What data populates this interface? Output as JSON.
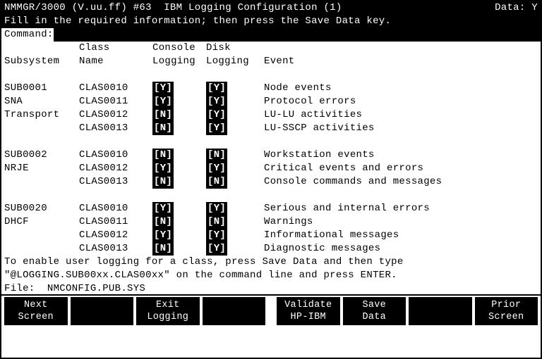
{
  "header": {
    "left": "NMMGR/3000 (V.uu.ff) #63  IBM Logging Configuration (1)",
    "right": "Data: Y",
    "instruction": "Fill in the required information; then press the Save Data key.",
    "command_label": "Command:"
  },
  "columns": {
    "subsystem": "Subsystem",
    "class_l1": "Class",
    "class_l2": "Name",
    "console_l1": "Console",
    "console_l2": "Logging",
    "disk_l1": "Disk",
    "disk_l2": "Logging",
    "event": "Event"
  },
  "groups": [
    {
      "subsystem": "SUB0001",
      "sublines": [
        "SNA",
        "Transport",
        ""
      ],
      "rows": [
        {
          "class": "CLAS0010",
          "console": "[Y]",
          "disk": "[Y]",
          "event": "Node events"
        },
        {
          "class": "CLAS0011",
          "console": "[Y]",
          "disk": "[Y]",
          "event": "Protocol errors"
        },
        {
          "class": "CLAS0012",
          "console": "[N]",
          "disk": "[Y]",
          "event": "LU-LU activities"
        },
        {
          "class": "CLAS0013",
          "console": "[N]",
          "disk": "[Y]",
          "event": "LU-SSCP activities"
        }
      ]
    },
    {
      "subsystem": "SUB0002",
      "sublines": [
        "NRJE",
        ""
      ],
      "rows": [
        {
          "class": "CLAS0010",
          "console": "[N]",
          "disk": "[N]",
          "event": "Workstation events"
        },
        {
          "class": "CLAS0012",
          "console": "[Y]",
          "disk": "[Y]",
          "event": "Critical events and errors"
        },
        {
          "class": "CLAS0013",
          "console": "[N]",
          "disk": "[N]",
          "event": "Console commands and messages"
        }
      ]
    },
    {
      "subsystem": "SUB0020",
      "sublines": [
        "DHCF",
        "",
        ""
      ],
      "rows": [
        {
          "class": "CLAS0010",
          "console": "[Y]",
          "disk": "[Y]",
          "event": "Serious and internal errors"
        },
        {
          "class": "CLAS0011",
          "console": "[N]",
          "disk": "[N]",
          "event": "Warnings"
        },
        {
          "class": "CLAS0012",
          "console": "[Y]",
          "disk": "[Y]",
          "event": "Informational messages"
        },
        {
          "class": "CLAS0013",
          "console": "[N]",
          "disk": "[Y]",
          "event": "Diagnostic messages"
        }
      ]
    }
  ],
  "footer_note_1": "To enable user logging for a class, press Save Data and then type",
  "footer_note_2": "\"@LOGGING.SUB00xx.CLAS00xx\" on the command line and press ENTER.",
  "file_line": "File:  NMCONFIG.PUB.SYS",
  "fkeys": [
    {
      "l1": "Next",
      "l2": "Screen"
    },
    {
      "l1": "",
      "l2": ""
    },
    {
      "l1": "Exit",
      "l2": "Logging"
    },
    {
      "l1": "",
      "l2": ""
    },
    {
      "l1": "Validate",
      "l2": "HP-IBM"
    },
    {
      "l1": "Save",
      "l2": "Data"
    },
    {
      "l1": "",
      "l2": ""
    },
    {
      "l1": "Prior",
      "l2": "Screen"
    }
  ]
}
